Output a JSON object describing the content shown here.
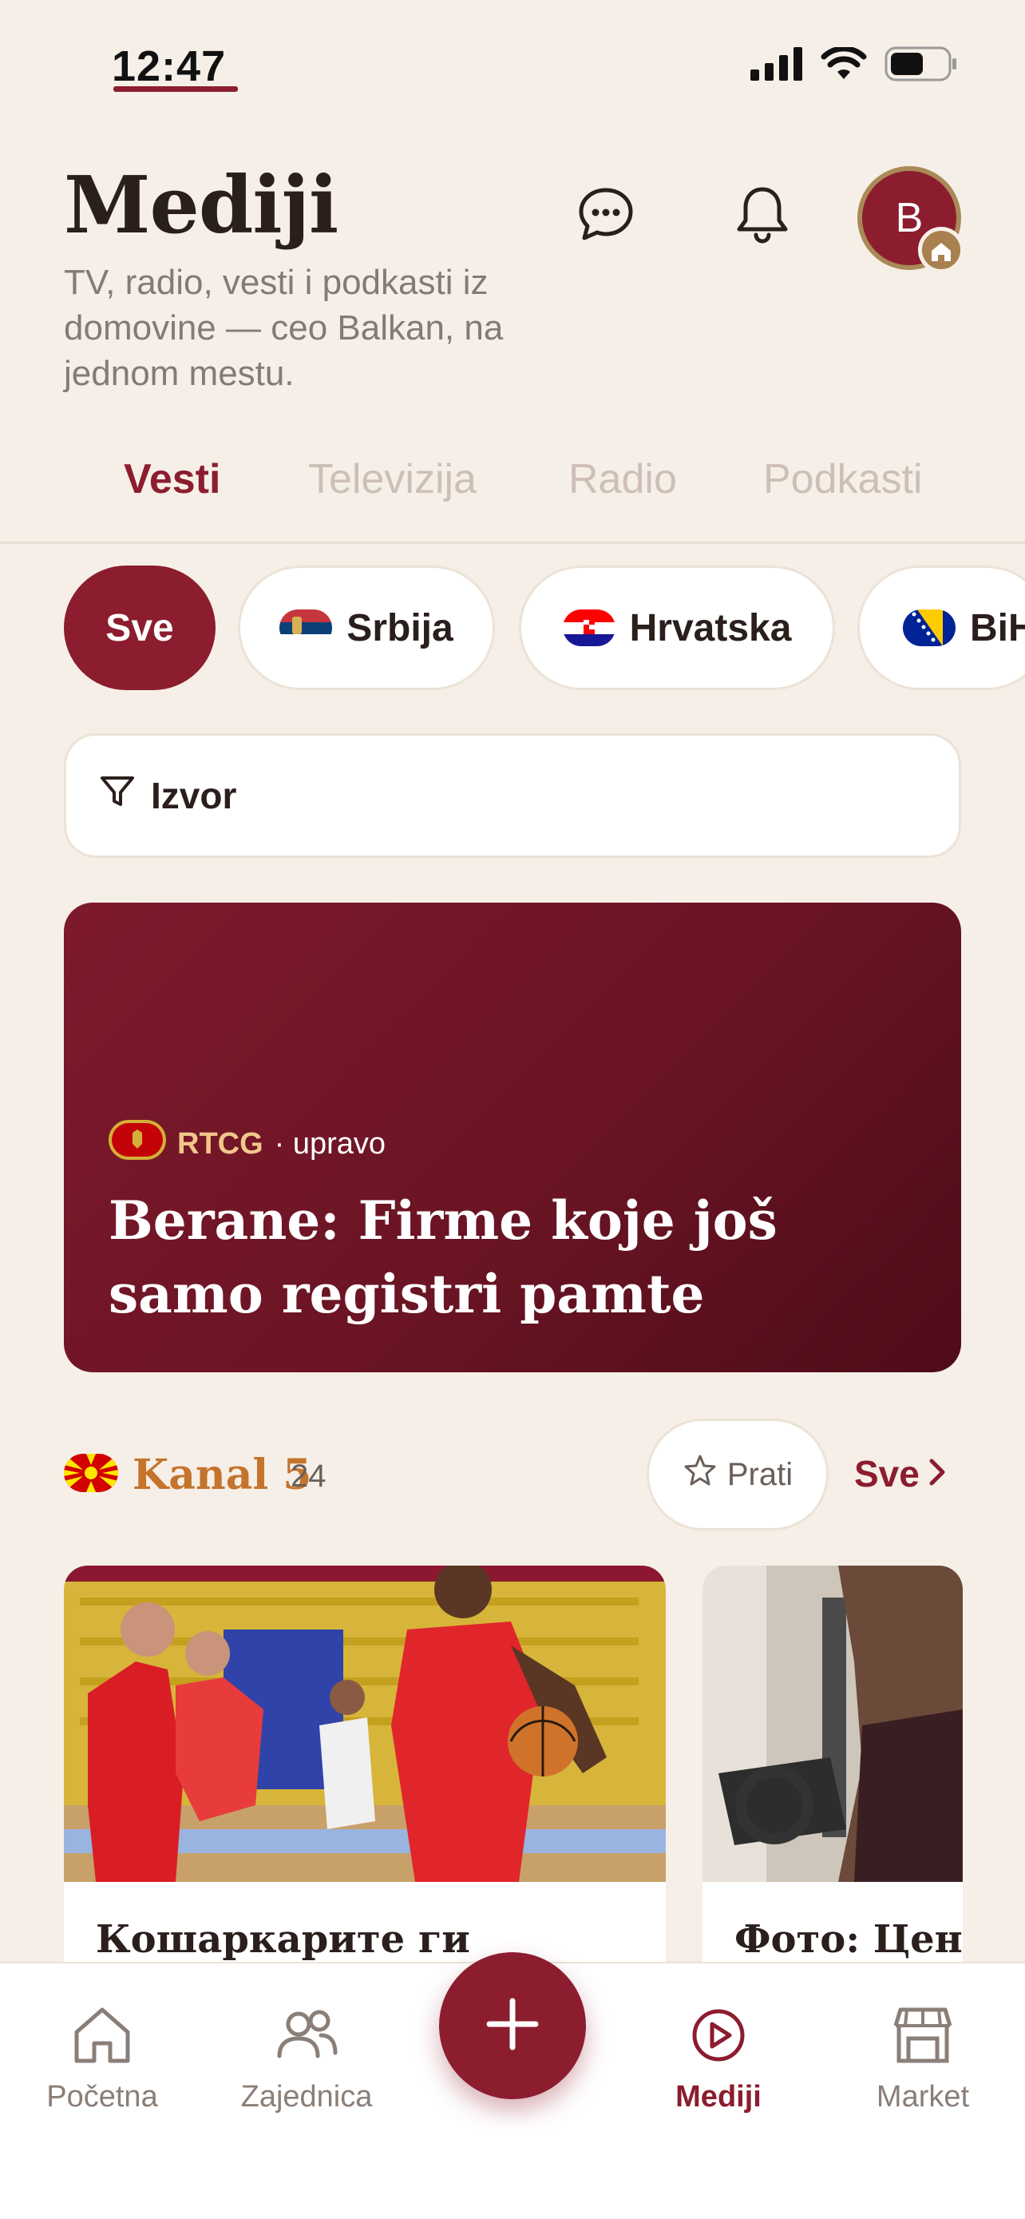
{
  "status_bar": {
    "time": "12:47"
  },
  "header": {
    "title": "Mediji",
    "subtitle": "TV, radio, vesti i podkasti iz domovine — ceo Balkan, na jednom mestu.",
    "avatar_initial": "B"
  },
  "tabs": [
    {
      "label": "Vesti",
      "active": true
    },
    {
      "label": "Televizija",
      "active": false
    },
    {
      "label": "Radio",
      "active": false
    },
    {
      "label": "Podkasti",
      "active": false
    }
  ],
  "country_chips": [
    {
      "label": "Sve",
      "active": true
    },
    {
      "label": "Srbija",
      "active": false
    },
    {
      "label": "Hrvatska",
      "active": false
    },
    {
      "label": "BiH",
      "active": false
    }
  ],
  "source_filter": {
    "label": "Izvor"
  },
  "featured": {
    "source": "RTCG",
    "time": "· upravo",
    "title": "Berane: Firme koje još samo registri pamte"
  },
  "channel": {
    "name": "Kanal 5",
    "count": "24",
    "follow_label": "Prati",
    "see_all_label": "Sve"
  },
  "news_cards": [
    {
      "title": "Кошаркарите ги"
    },
    {
      "title": "Фото: Цени"
    }
  ],
  "bottom_nav": [
    {
      "label": "Početna",
      "active": false
    },
    {
      "label": "Zajednica",
      "active": false
    },
    {
      "label": "Mediji",
      "active": true
    },
    {
      "label": "Market",
      "active": false
    }
  ],
  "colors": {
    "accent": "#8b1d2e",
    "background": "#f6efe7",
    "channel": "#c4742d",
    "source_gold": "#f2c78a"
  }
}
